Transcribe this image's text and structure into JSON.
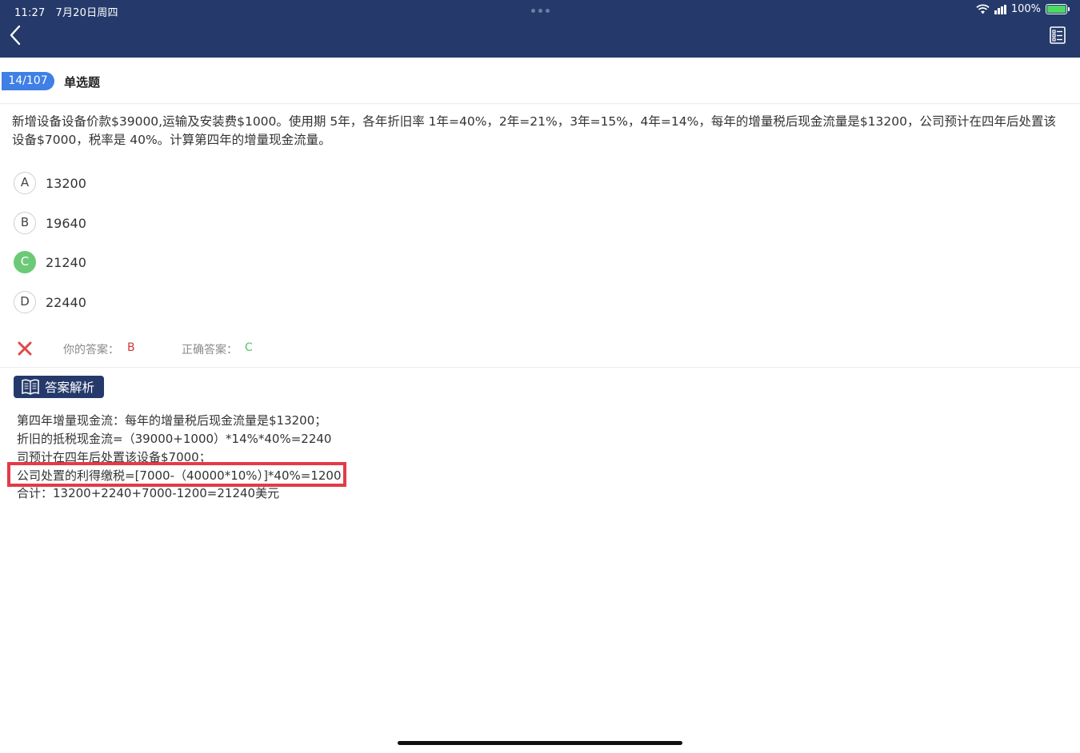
{
  "status_bar": {
    "time": "11:27",
    "date": "7月20日周四",
    "battery": "100%"
  },
  "nav": {
    "back_icon": "chevron-left-icon",
    "answer_sheet_icon": "answer-sheet-icon"
  },
  "question": {
    "progress": "14/107",
    "type": "单选题",
    "text": "新增设备设备价款$39000,运输及安装费$1000。使用期 5年，各年折旧率 1年=40%，2年=21%，3年=15%，4年=14%，每年的增量税后现金流量是$13200，公司预计在四年后处置该设备$7000，税率是 40%。计算第四年的增量现金流量。",
    "options": [
      {
        "letter": "A",
        "value": "13200"
      },
      {
        "letter": "B",
        "value": "19640"
      },
      {
        "letter": "C",
        "value": "21240"
      },
      {
        "letter": "D",
        "value": "22440"
      }
    ]
  },
  "result": {
    "status_icon": "wrong-x-icon",
    "your_answer_label": "你的答案：",
    "your_answer": "B",
    "correct_answer_label": "正确答案：",
    "correct_answer": "C",
    "colors": {
      "wrong": "#d0373a",
      "correct": "#5bbf6b"
    }
  },
  "analysis": {
    "tag_label": "答案解析",
    "tag_icon": "book-icon",
    "lines": [
      "第四年增量现金流：每年的增量税后现金流量是$13200；",
      "折旧的抵税现金流=（39000+1000）*14%*40%=2240",
      "司预计在四年后处置该设备$7000；",
      "公司处置的利得缴税=[7000-（40000*10%）]*40%=1200",
      "合计：13200+2240+7000-1200=21240美元"
    ]
  },
  "theme": {
    "header_bg": "#253a6a",
    "progress_badge": "#3f7fe6",
    "highlight": "#e23b48"
  }
}
